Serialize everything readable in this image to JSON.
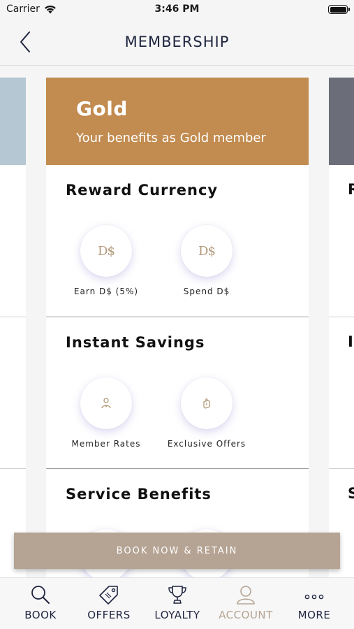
{
  "status_bar": {
    "carrier": "Carrier",
    "time": "3:46 PM"
  },
  "nav": {
    "title": "MEMBERSHIP",
    "back_icon": "chevron-left-icon"
  },
  "tier": {
    "name": "Gold",
    "subtitle": "Your benefits as Gold member",
    "header_color": "#c28b4f"
  },
  "sections": [
    {
      "title": "Reward Currency",
      "benefits": [
        {
          "label": "Earn D$ (5%)",
          "icon_text": "D$",
          "icon": "ds-currency-icon"
        },
        {
          "label": "Spend D$",
          "icon_text": "D$",
          "icon": "ds-currency-icon"
        }
      ]
    },
    {
      "title": "Instant Savings",
      "benefits": [
        {
          "label": "Member Rates",
          "icon": "person-icon"
        },
        {
          "label": "Exclusive Offers",
          "icon": "gift-icon"
        }
      ]
    },
    {
      "title": "Service Benefits",
      "benefits": []
    }
  ],
  "peek_right_letters": [
    "R",
    "I",
    "S"
  ],
  "cta": {
    "label": "BOOK NOW & RETAIN",
    "color": "#b5a393"
  },
  "tab_bar": {
    "tabs": [
      {
        "label": "BOOK",
        "icon": "search-icon",
        "active": true
      },
      {
        "label": "OFFERS",
        "icon": "tag-icon",
        "active": true
      },
      {
        "label": "LOYALTY",
        "icon": "trophy-icon",
        "active": true
      },
      {
        "label": "ACCOUNT",
        "icon": "account-icon",
        "active": false
      },
      {
        "label": "MORE",
        "icon": "more-icon",
        "active": true
      }
    ]
  },
  "colors": {
    "accent": "#1f2540",
    "left_card": "#b4c7d2",
    "right_card": "#6b6d78"
  }
}
